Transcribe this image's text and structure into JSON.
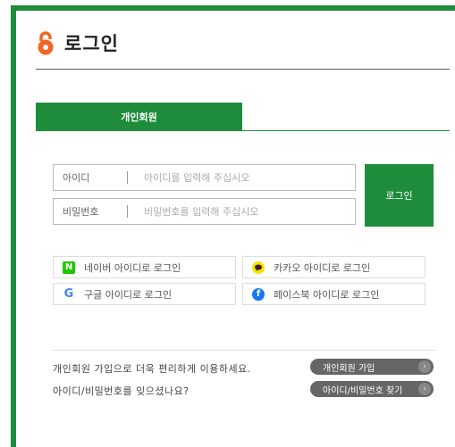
{
  "header": {
    "title": "로그인"
  },
  "tabs": [
    {
      "label": "개인회원"
    }
  ],
  "form": {
    "id_label": "아이디",
    "id_placeholder": "아이디를 입력해 주십시오",
    "pw_label": "비밀번호",
    "pw_placeholder": "비밀번호를 입력해 주십시오",
    "login_label": "로그인"
  },
  "social": {
    "naver": {
      "label": "네이버 아이디로 로그인",
      "icon": "naver-icon",
      "glyph": "N",
      "color": "#1ec800"
    },
    "kakao": {
      "label": "카카오 아이디로 로그인",
      "icon": "kakao-icon",
      "color": "#fae100"
    },
    "google": {
      "label": "구글 아이디로 로그인",
      "icon": "google-icon",
      "glyph": "G",
      "color": "#4285f4"
    },
    "facebook": {
      "label": "페이스북 아이디로 로그인",
      "icon": "facebook-icon",
      "glyph": "f",
      "color": "#1877f2"
    }
  },
  "footer": {
    "join_text": "개인회원 가입으로 더욱 편리하게 이용하세요.",
    "join_button": "개인회원 가입",
    "find_text": "아이디/비밀번호를 잊으셨나요?",
    "find_button": "아이디/비밀번호 찾기",
    "chevron": "›"
  },
  "colors": {
    "accent": "#1e8c3a",
    "lock": "#f26522"
  }
}
